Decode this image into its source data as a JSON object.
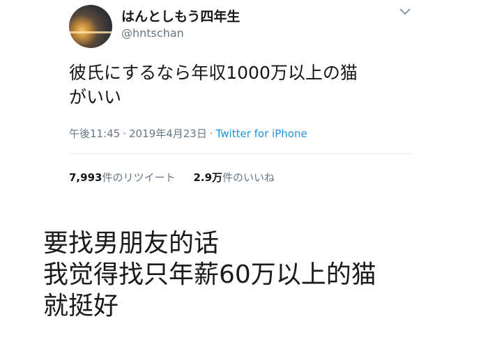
{
  "tweet": {
    "display_name": "はんとしもう四年生",
    "handle": "@hntschan",
    "text_lines": [
      "彼氏にするなら年収1000万以上の猫",
      "がいい"
    ],
    "time": "午後11:45",
    "separator": "·",
    "date": "2019年4月23日",
    "source": "Twitter for iPhone",
    "retweets": {
      "count": "7,993",
      "label": "件のリツイート"
    },
    "likes": {
      "count": "2.9万",
      "label": "件のいいね"
    },
    "menu_icon": "chevron-down-icon",
    "avatar_icon": "avatar"
  },
  "caption_lines": [
    "要找男朋友的话",
    "我觉得找只年薪60万以上的猫",
    "就挺好"
  ],
  "colors": {
    "text": "#14171a",
    "secondary": "#657786",
    "link": "#1b95e0",
    "divider": "#e6ecf0"
  }
}
